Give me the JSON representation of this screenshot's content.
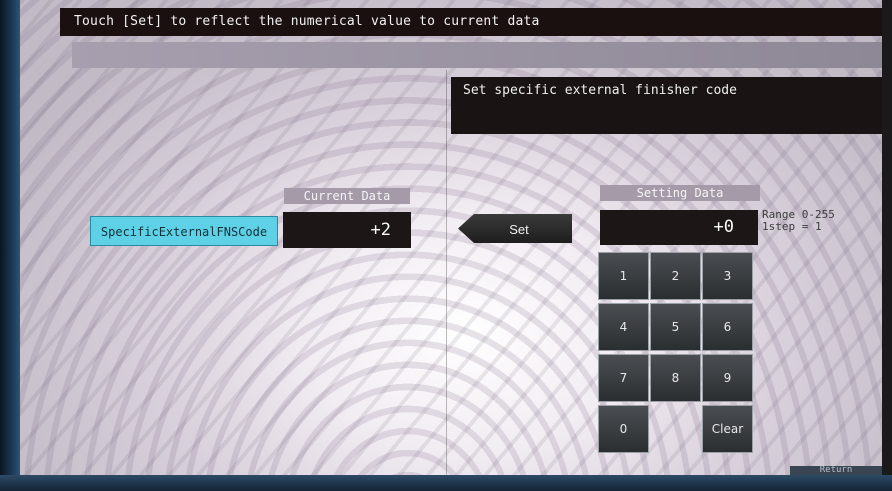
{
  "header": {
    "instruction": "Touch [Set] to reflect the numerical value to current data"
  },
  "description": {
    "text": "Set specific external finisher code"
  },
  "parameter": {
    "label": "SpecificExternalFNSCode"
  },
  "current": {
    "header": "Current Data",
    "value": "+2"
  },
  "set_button": {
    "label": "Set"
  },
  "setting": {
    "header": "Setting Data",
    "value": "+0"
  },
  "range": {
    "line1": "Range 0-255",
    "line2": "1step = 1"
  },
  "keypad": {
    "k1": "1",
    "k2": "2",
    "k3": "3",
    "k4": "4",
    "k5": "5",
    "k6": "6",
    "k7": "7",
    "k8": "8",
    "k9": "9",
    "k0": "0",
    "clear": "Clear"
  },
  "footer": {
    "return_label": "Return"
  }
}
